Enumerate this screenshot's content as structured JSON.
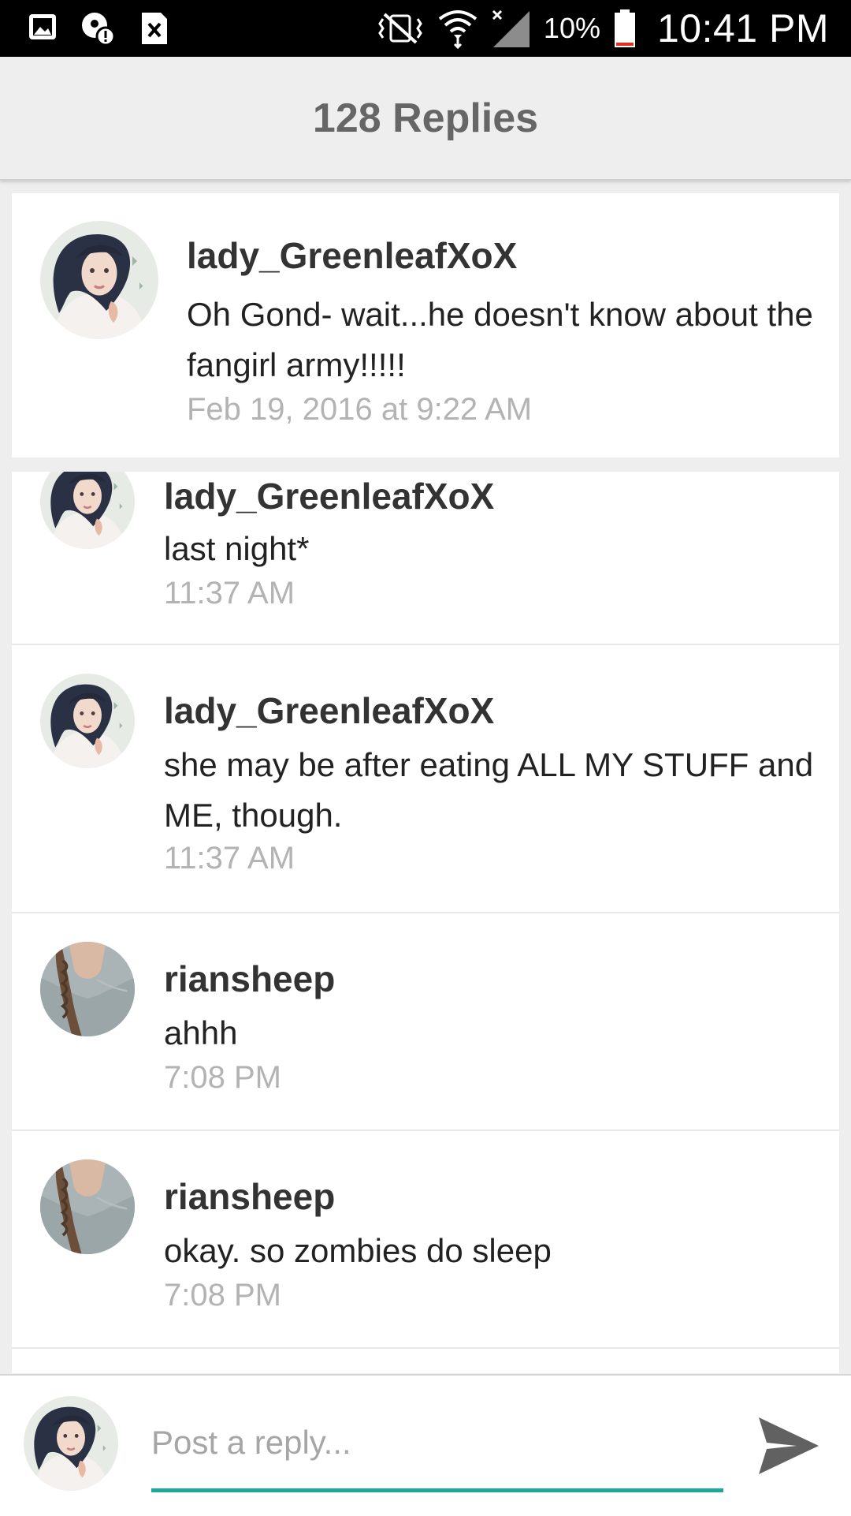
{
  "status_bar": {
    "left_icons": [
      "gallery-icon",
      "location-alert-icon",
      "dismiss-notification-icon"
    ],
    "right_icons": [
      "vibrate-icon",
      "wifi-icon",
      "cell-signal-icon",
      "battery-icon"
    ],
    "battery": "10%",
    "time": "10:41 PM"
  },
  "header": {
    "title": "128 Replies"
  },
  "original_post": {
    "username": "lady_GreenleafXoX",
    "text": "Oh Gond- wait...he doesn't know about the fangirl army!!!!!",
    "timestamp": "Feb 19, 2016 at 9:22 AM"
  },
  "replies": [
    {
      "username": "lady_GreenleafXoX",
      "text": "last night*",
      "timestamp": "11:37 AM"
    },
    {
      "username": "lady_GreenleafXoX",
      "text": "she may be after  eating ALL MY STUFF and ME, though.",
      "timestamp": "11:37 AM"
    },
    {
      "username": "riansheep",
      "text": "ahhh",
      "timestamp": "7:08 PM"
    },
    {
      "username": "riansheep",
      "text": "okay. so zombies do sleep",
      "timestamp": "7:08 PM"
    }
  ],
  "composer": {
    "placeholder": "Post a reply...",
    "send_icon": "send-icon"
  },
  "colors": {
    "accent": "#1aa99b",
    "header_bg": "#eeeeee",
    "timestamp": "#b3b3b3"
  }
}
